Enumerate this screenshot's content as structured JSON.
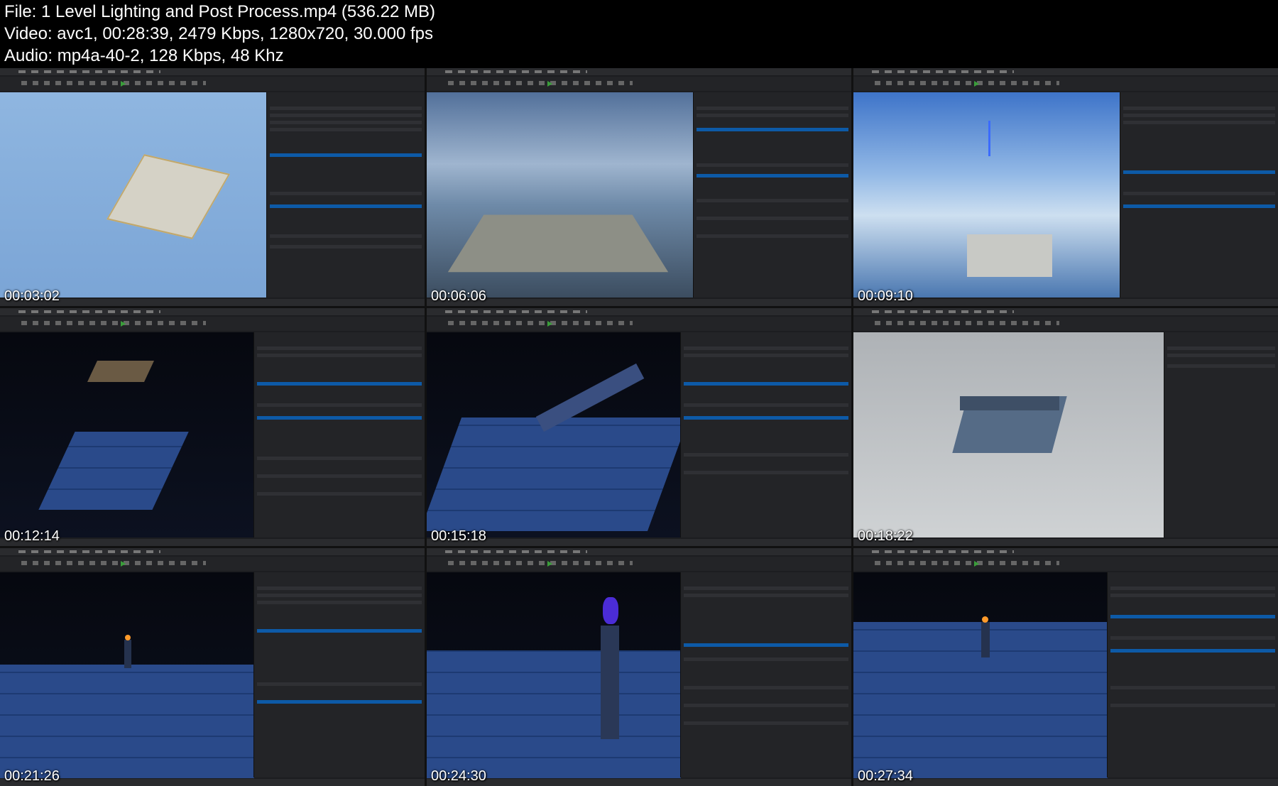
{
  "header": {
    "file_line": "File: 1  Level Lighting and Post Process.mp4 (536.22 MB)",
    "video_line": "Video: avc1, 00:28:39, 2479 Kbps, 1280x720, 30.000 fps",
    "audio_line": "Audio: mp4a-40-2, 128 Kbps, 48 Khz"
  },
  "thumbnails": [
    {
      "timestamp": "00:03:02",
      "scene": "sky-blue"
    },
    {
      "timestamp": "00:06:06",
      "scene": "cloud-sky"
    },
    {
      "timestamp": "00:09:10",
      "scene": "bright-sky"
    },
    {
      "timestamp": "00:12:14",
      "scene": "night"
    },
    {
      "timestamp": "00:15:18",
      "scene": "night"
    },
    {
      "timestamp": "00:18:22",
      "scene": "gray-room"
    },
    {
      "timestamp": "00:21:26",
      "scene": "night"
    },
    {
      "timestamp": "00:24:30",
      "scene": "night"
    },
    {
      "timestamp": "00:27:34",
      "scene": "night"
    }
  ]
}
